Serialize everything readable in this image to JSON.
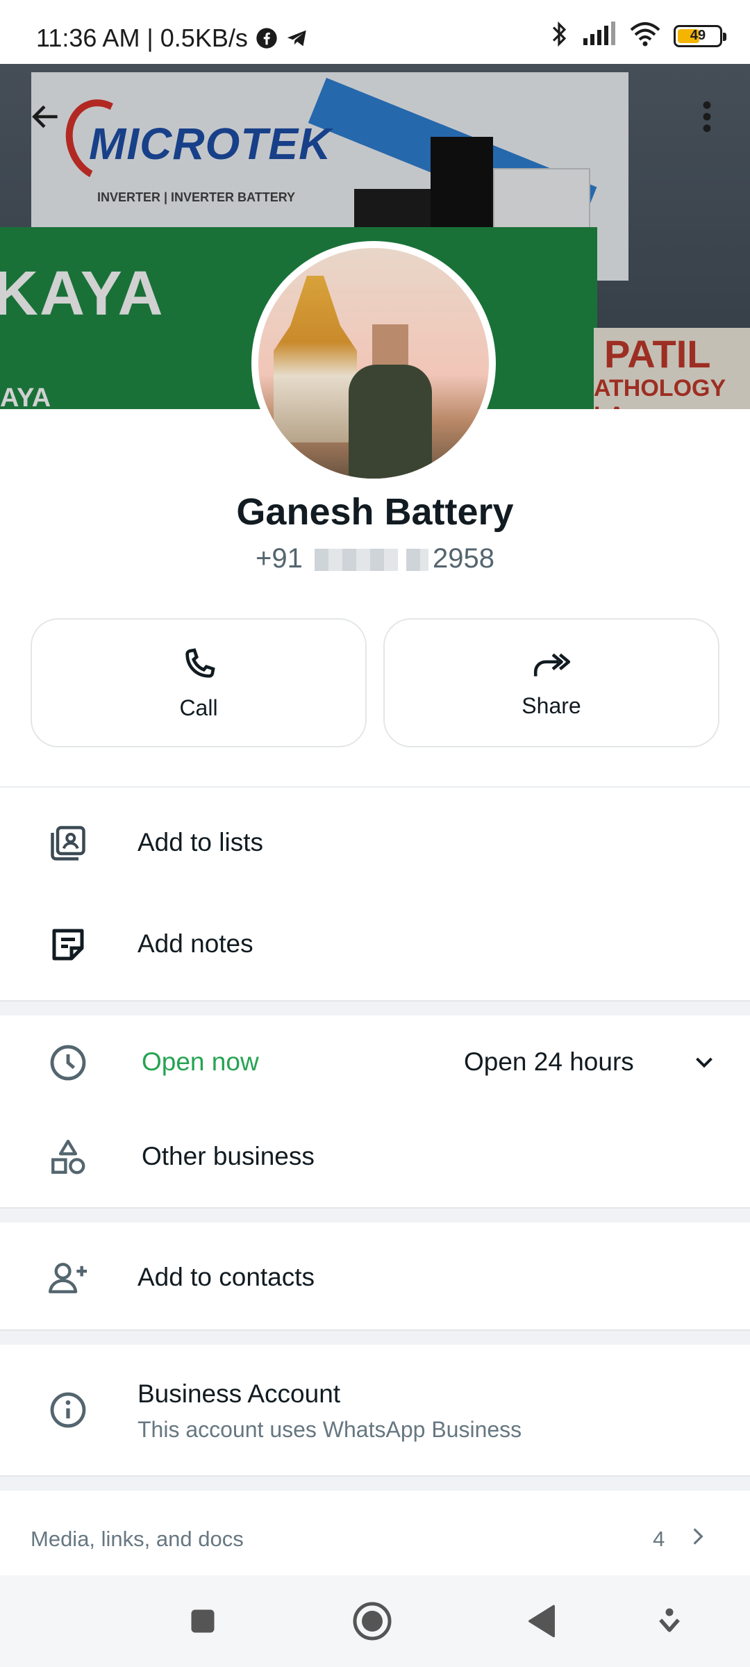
{
  "status_bar": {
    "time_speed": "11:36 AM | 0.5KB/s",
    "battery_level": "49"
  },
  "profile": {
    "name": "Ganesh Battery",
    "phone_prefix": "+91",
    "phone_suffix": "2958"
  },
  "actions": {
    "call_label": "Call",
    "share_label": "Share"
  },
  "list_actions": {
    "add_to_lists": "Add to lists",
    "add_notes": "Add notes"
  },
  "business_info": {
    "open_status": "Open now",
    "hours": "Open 24 hours",
    "category": "Other business"
  },
  "contacts": {
    "add_to_contacts": "Add to contacts"
  },
  "business_account": {
    "title": "Business Account",
    "subtitle": "This account uses WhatsApp Business"
  },
  "media": {
    "label": "Media, links, and docs",
    "count": "4"
  },
  "cover": {
    "brand_text": "MICROTEK",
    "brand_sub": "INVERTER | INVERTER BATTERY",
    "green_sign_text": "KAYA",
    "green_sign_text2": "AYA",
    "right_sign_text": "PATIL",
    "right_sign_sub": "ATHOLOGY LA"
  },
  "colors": {
    "accent_green": "#25a352",
    "text_primary": "#111b21",
    "text_secondary": "#667781"
  }
}
